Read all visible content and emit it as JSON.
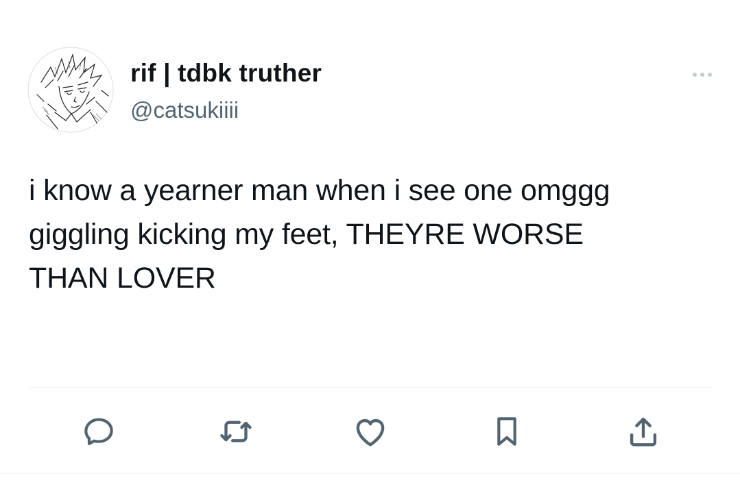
{
  "author": {
    "display_name": "rif | tdbk truther",
    "handle": "@catsukiiii",
    "avatar_icon": "anime-sketch-avatar"
  },
  "tweet": {
    "text": "i know a yearner man when i see one omggg\ngiggling kicking my feet, THEYRE WORSE\nTHAN LOVER"
  },
  "menu": {
    "icon": "more-horizontal-icon"
  },
  "actions": [
    {
      "name": "reply",
      "icon": "comment-bubble-icon"
    },
    {
      "name": "retweet",
      "icon": "retweet-arrows-icon"
    },
    {
      "name": "like",
      "icon": "heart-icon"
    },
    {
      "name": "bookmark",
      "icon": "bookmark-icon"
    },
    {
      "name": "share",
      "icon": "share-upload-icon"
    }
  ],
  "colors": {
    "text_primary": "#0f1419",
    "text_secondary": "#536471",
    "icon": "#536471",
    "divider": "#eff3f4"
  }
}
